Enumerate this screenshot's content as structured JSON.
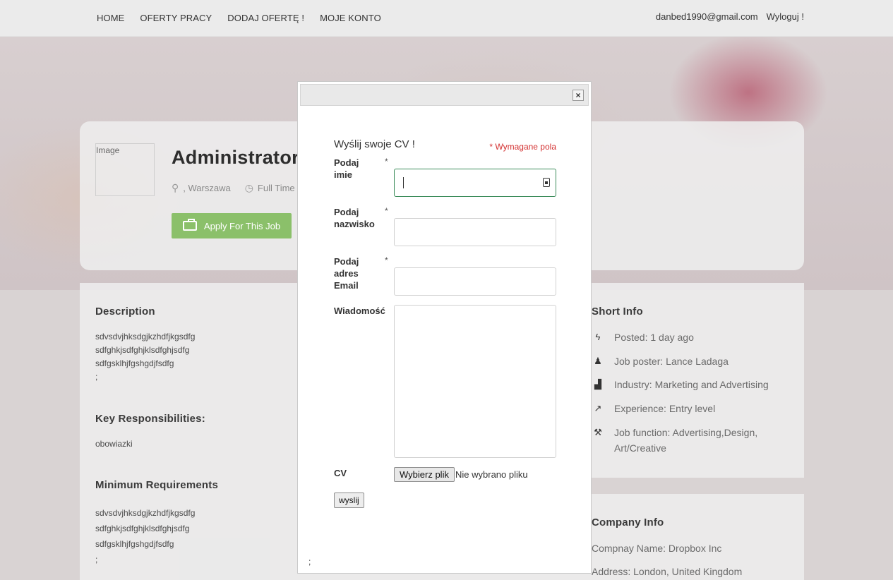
{
  "nav": {
    "items": [
      "HOME",
      "OFERTY PRACY",
      "DODAJ OFERTĘ !",
      "MOJE KONTO"
    ],
    "user_email": "danbed1990@gmail.com",
    "logout": "Wyloguj !"
  },
  "job": {
    "logo_alt": "Image",
    "title": "Administrator",
    "location": ", Warszawa",
    "type": "Full Time",
    "apply_label": "Apply For This Job"
  },
  "sections": {
    "description": {
      "heading": "Description",
      "text": "sdvsdvjhksdgjkzhdfjkgsdfg\nsdfghkjsdfghjklsdfghjsdfg\nsdfgsklhjfgshgdjfsdfg\n;"
    },
    "responsibilities": {
      "heading": "Key Responsibilities:",
      "text": "obowiazki"
    },
    "requirements": {
      "heading": "Minimum Requirements",
      "text": "sdvsdvjhksdgjkzhdfjkgsdfg\nsdfghkjsdfghjklsdfghjsdfg\nsdfgsklhjfgshgdjfsdfg\n;"
    }
  },
  "short_info": {
    "heading": "Short Info",
    "items": [
      {
        "icon": "bolt-icon",
        "text": "Posted: 1 day ago"
      },
      {
        "icon": "user-plus-icon",
        "text": "Job poster: Lance Ladaga"
      },
      {
        "icon": "industry-icon",
        "text": "Industry: Marketing and Advertising"
      },
      {
        "icon": "trend-icon",
        "text": "Experience: Entry level"
      },
      {
        "icon": "tools-icon",
        "text": "Job function: Advertising,Design, Art/Creative"
      }
    ]
  },
  "company_info": {
    "heading": "Company Info",
    "name": "Compnay Name: Dropbox Inc",
    "address": "Address: London, United Kingdom"
  },
  "modal": {
    "title": "Wyślij swoje CV !",
    "required_note": "* Wymagane pola",
    "first_name_label": "Podaj imie",
    "last_name_label": "Podaj nazwisko",
    "email_label": "Podaj adres Email",
    "message_label": "Wiadomość",
    "cv_label": "CV",
    "required_mark": "*",
    "file_button": "Wybierz plik",
    "file_status": "Nie wybrano pliku",
    "submit": "wyslij",
    "footer_text": ";",
    "close_symbol": "×"
  }
}
